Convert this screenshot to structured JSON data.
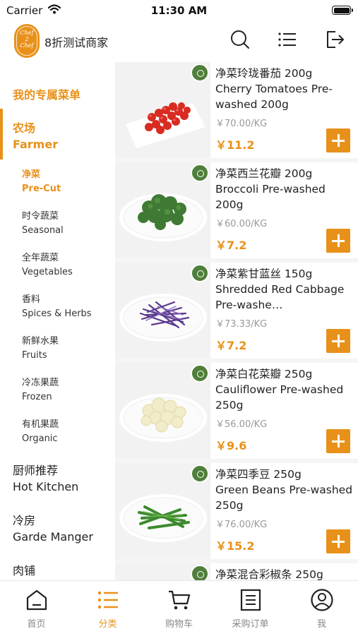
{
  "status_bar": {
    "carrier": "Carrier",
    "time": "11:30 AM"
  },
  "header": {
    "logo_text_1": "Chef",
    "logo_text_2": "2",
    "logo_text_3": "Chef",
    "store_name": "8折测试商家",
    "icons": [
      "search-icon",
      "list-icon",
      "logout-icon"
    ]
  },
  "sidebar": {
    "favorites_label": "我的专属菜单",
    "farm": {
      "cn": "农场",
      "en": "Farmer"
    },
    "sub_items": [
      {
        "cn": "净菜",
        "en": "Pre-Cut"
      },
      {
        "cn": "时令蔬菜",
        "en": "Seasonal"
      },
      {
        "cn": "全年蔬菜",
        "en": "Vegetables"
      },
      {
        "cn": "香料",
        "en": "Spices & Herbs"
      },
      {
        "cn": "新鲜水果",
        "en": "Fruits"
      },
      {
        "cn": "冷冻果蔬",
        "en": "Frozen"
      },
      {
        "cn": "有机果蔬",
        "en": "Organic"
      }
    ],
    "categories": [
      {
        "cn": "厨师推荐",
        "en": "Hot Kitchen"
      },
      {
        "cn": "冷房",
        "en": "Garde Manger"
      },
      {
        "cn": "肉铺",
        "en": ""
      }
    ]
  },
  "products": [
    {
      "cn": "净菜玲珑番茄  200g",
      "en": "Cherry Tomatoes Pre-washed 200g",
      "unit_price": "￥70.00/KG",
      "price": "￥11.2"
    },
    {
      "cn": "净菜西兰花瓣 200g",
      "en": "Broccoli Pre-washed 200g",
      "unit_price": "￥60.00/KG",
      "price": "￥7.2"
    },
    {
      "cn": "净菜紫甘蓝丝 150g",
      "en": "Shredded Red Cabbage Pre-washe…",
      "unit_price": "￥73.33/KG",
      "price": "￥7.2"
    },
    {
      "cn": "净菜白花菜瓣 250g",
      "en": "Cauliflower Pre-washed 250g",
      "unit_price": "￥56.00/KG",
      "price": "￥9.6"
    },
    {
      "cn": "净菜四季豆 250g",
      "en": "Green Beans Pre-washed 250g",
      "unit_price": "￥76.00/KG",
      "price": "￥15.2"
    },
    {
      "cn": "净菜混合彩椒条 250g",
      "en": "",
      "unit_price": "",
      "price": ""
    }
  ],
  "tabbar": [
    {
      "label": "首页",
      "icon": "home-icon"
    },
    {
      "label": "分类",
      "icon": "category-icon"
    },
    {
      "label": "购物车",
      "icon": "cart-icon"
    },
    {
      "label": "采购订单",
      "icon": "order-icon"
    },
    {
      "label": "我",
      "icon": "profile-icon"
    }
  ],
  "colors": {
    "accent": "#e8911a",
    "badge": "#4f7f3a"
  }
}
